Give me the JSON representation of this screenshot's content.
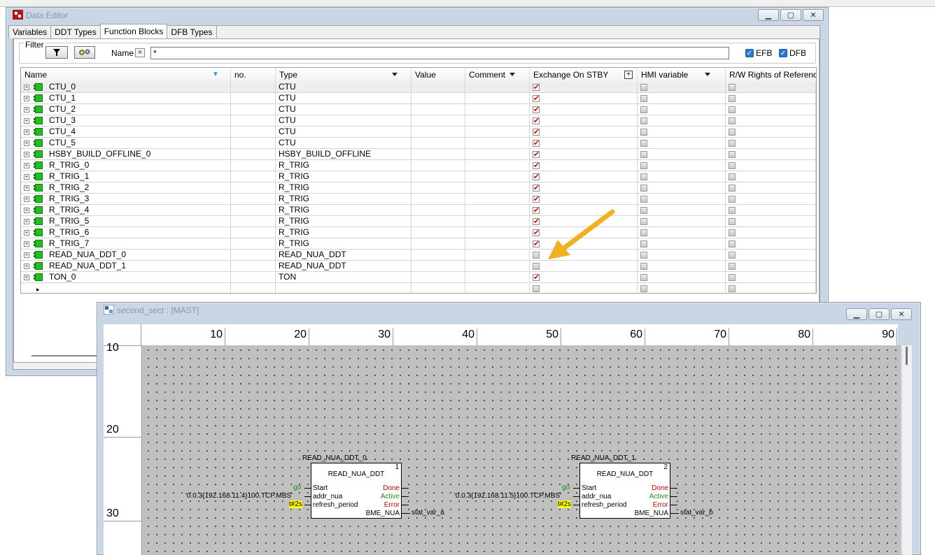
{
  "data_editor": {
    "title": "Data Editor",
    "tabs": [
      "Variables",
      "DDT Types",
      "Function Blocks",
      "DFB Types"
    ],
    "active_tab": "Function Blocks",
    "filter": {
      "legend": "Filter",
      "name_label": "Name",
      "eq_symbol": "=",
      "name_value": "*",
      "efb_label": "EFB",
      "dfb_label": "DFB"
    },
    "columns": [
      "Name",
      "no.",
      "Type",
      "Value",
      "Comment",
      "Exchange On STBY",
      "HMI variable",
      "R/W Rights of References"
    ],
    "rows": [
      {
        "name": "CTU_0",
        "type": "CTU",
        "stby": true
      },
      {
        "name": "CTU_1",
        "type": "CTU",
        "stby": true
      },
      {
        "name": "CTU_2",
        "type": "CTU",
        "stby": true
      },
      {
        "name": "CTU_3",
        "type": "CTU",
        "stby": true
      },
      {
        "name": "CTU_4",
        "type": "CTU",
        "stby": true
      },
      {
        "name": "CTU_5",
        "type": "CTU",
        "stby": true
      },
      {
        "name": "HSBY_BUILD_OFFLINE_0",
        "type": "HSBY_BUILD_OFFLINE",
        "stby": true
      },
      {
        "name": "R_TRIG_0",
        "type": "R_TRIG",
        "stby": true
      },
      {
        "name": "R_TRIG_1",
        "type": "R_TRIG",
        "stby": true
      },
      {
        "name": "R_TRIG_2",
        "type": "R_TRIG",
        "stby": true
      },
      {
        "name": "R_TRIG_3",
        "type": "R_TRIG",
        "stby": true
      },
      {
        "name": "R_TRIG_4",
        "type": "R_TRIG",
        "stby": true
      },
      {
        "name": "R_TRIG_5",
        "type": "R_TRIG",
        "stby": true
      },
      {
        "name": "R_TRIG_6",
        "type": "R_TRIG",
        "stby": true
      },
      {
        "name": "R_TRIG_7",
        "type": "R_TRIG",
        "stby": true
      },
      {
        "name": "READ_NUA_DDT_0",
        "type": "READ_NUA_DDT",
        "stby": false
      },
      {
        "name": "READ_NUA_DDT_1",
        "type": "READ_NUA_DDT",
        "stby": false
      },
      {
        "name": "TON_0",
        "type": "TON",
        "stby": true
      }
    ],
    "colors": {
      "check_red": "#d01010",
      "fb_icon_green": "#1ec01e",
      "arrow": "#f0b020"
    }
  },
  "section": {
    "title": "second_sect : [MAST]",
    "col_ruler": [
      "10",
      "20",
      "30",
      "40",
      "50",
      "60",
      "70",
      "80",
      "90"
    ],
    "row_ruler": [
      "10",
      "20",
      "30"
    ],
    "blocks": [
      {
        "instance": "READ_NUA_DDT_0",
        "type": "READ_NUA_DDT",
        "number": "1",
        "inputs": [
          "Start",
          "addr_nua",
          "refresh_period"
        ],
        "outputs": [
          "Done",
          "Active",
          "Error",
          "BME_NUA"
        ],
        "in_go": "go",
        "in_addr": "'0.0.3{192.168.11.4}100.TCP.MBS'",
        "in_period": "t#2s",
        "out_var": "stat_var_a"
      },
      {
        "instance": "READ_NUA_DDT_1",
        "type": "READ_NUA_DDT",
        "number": "2",
        "inputs": [
          "Start",
          "addr_nua",
          "refresh_period"
        ],
        "outputs": [
          "Done",
          "Active",
          "Error",
          "BME_NUA"
        ],
        "in_go": "go",
        "in_addr": "'0.0.3{192.168.11.5}100.TCP.MBS'",
        "in_period": "t#2s",
        "out_var": "stat_var_b"
      }
    ]
  }
}
